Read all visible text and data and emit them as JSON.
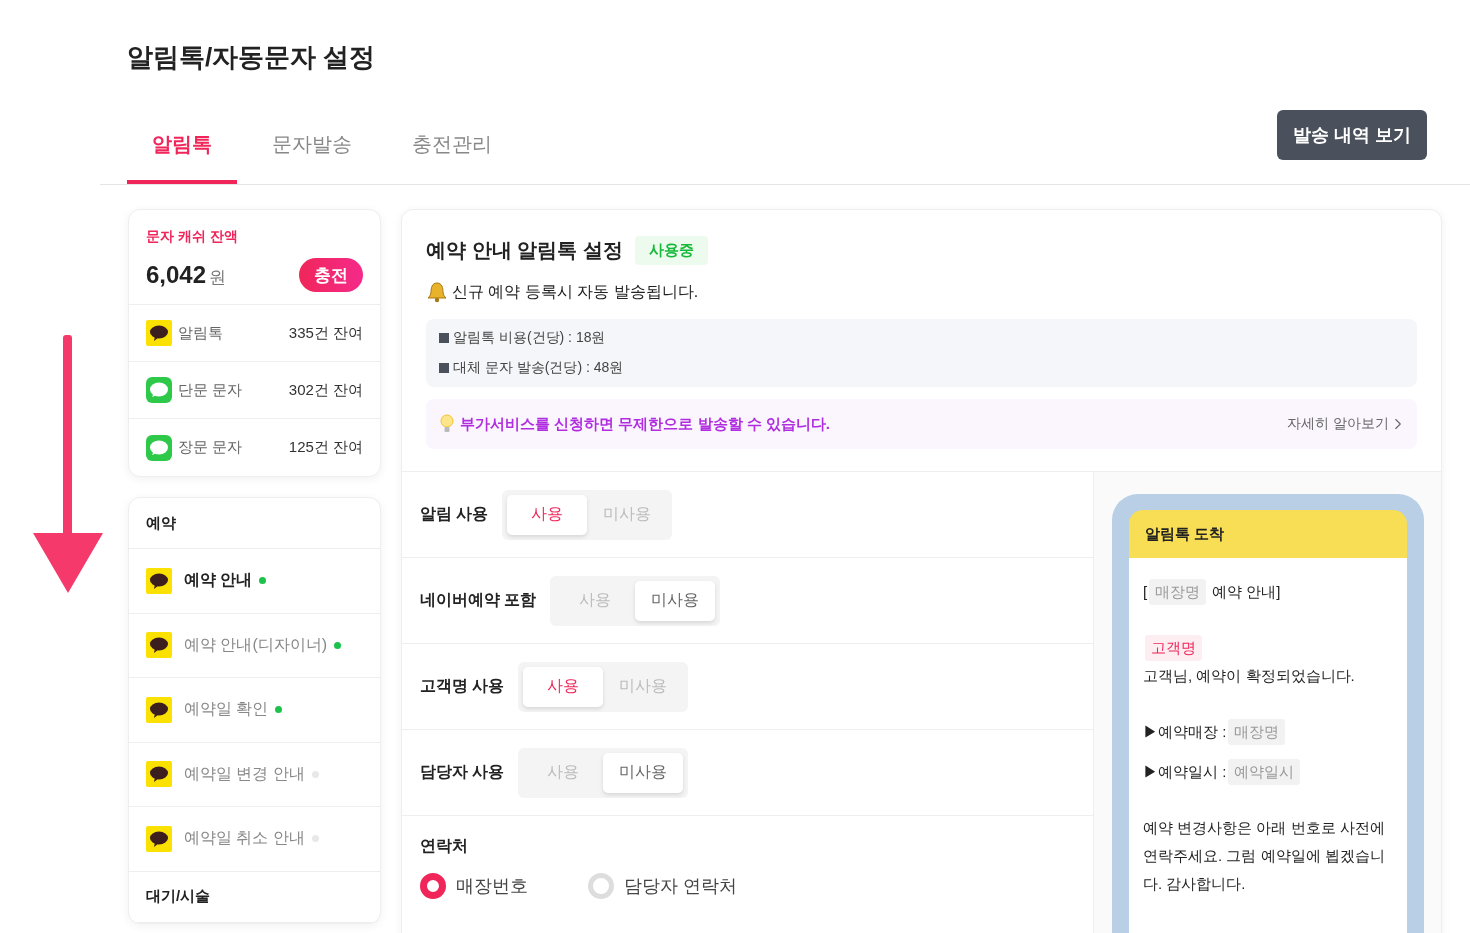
{
  "page_title": "알림톡/자동문자 설정",
  "tabs": [
    {
      "label": "알림톡",
      "selected": true
    },
    {
      "label": "문자발송",
      "selected": false
    },
    {
      "label": "충전관리",
      "selected": false
    }
  ],
  "history_button": "발송 내역 보기",
  "balance": {
    "label": "문자 캐쉬 잔액",
    "amount": "6,042",
    "unit": "원",
    "charge_button": "충전",
    "rows": [
      {
        "kind": "talk",
        "name": "알림톡",
        "count": "335건 잔여"
      },
      {
        "kind": "sms",
        "name": "단문 문자",
        "count": "302건 잔여"
      },
      {
        "kind": "sms",
        "name": "장문 문자",
        "count": "125건 잔여"
      }
    ]
  },
  "menu": [
    {
      "title": "예약",
      "items": [
        {
          "label": "예약 안내",
          "selected": true,
          "on": true
        },
        {
          "label": "예약 안내(디자이너)",
          "selected": false,
          "on": true
        },
        {
          "label": "예약일 확인",
          "selected": false,
          "on": true
        },
        {
          "label": "예약일 변경 안내",
          "selected": false,
          "on": false
        },
        {
          "label": "예약일 취소 안내",
          "selected": false,
          "on": false
        }
      ]
    },
    {
      "title": "대기/시술"
    }
  ],
  "detail": {
    "title": "예약 안내 알림톡 설정",
    "status": "사용중",
    "notice": "신규 예약 등록시 자동 발송됩니다.",
    "costs": [
      "알림톡 비용(건당) : 18원",
      "대체 문자 발송(건당) : 48원"
    ],
    "promo": "부가서비스를 신청하면 무제한으로 발송할 수 있습니다.",
    "promo_link": "자세히 알아보기",
    "settings": [
      {
        "label": "알림 사용",
        "options": [
          {
            "label": "사용",
            "selected": true
          },
          {
            "label": "미사용",
            "selected": false
          }
        ]
      },
      {
        "label": "네이버예약 포함",
        "options": [
          {
            "label": "사용",
            "selected": false
          },
          {
            "label": "미사용",
            "selected": true
          }
        ]
      },
      {
        "label": "고객명 사용",
        "options": [
          {
            "label": "사용",
            "selected": true
          },
          {
            "label": "미사용",
            "selected": false
          }
        ]
      },
      {
        "label": "담당자 사용",
        "options": [
          {
            "label": "사용",
            "selected": false
          },
          {
            "label": "미사용",
            "selected": true
          }
        ]
      }
    ],
    "contact": {
      "label": "연락처",
      "options": [
        {
          "label": "매장번호",
          "selected": true
        },
        {
          "label": "담당자 연락처",
          "selected": false
        }
      ]
    },
    "preview": {
      "header": "알림톡 도착",
      "paragraphs": [
        [
          {
            "kind": "text",
            "text": "["
          },
          {
            "kind": "var",
            "text": "매장명"
          },
          {
            "kind": "text",
            "text": "예약 안내]"
          }
        ],
        [
          {
            "kind": "name",
            "text": "고객명"
          },
          {
            "kind": "text",
            "text": "고객님, 예약이 확정되었습니다."
          }
        ],
        [
          {
            "kind": "text",
            "text": "▶예약매장 :"
          },
          {
            "kind": "var",
            "text": "매장명"
          }
        ],
        [
          {
            "kind": "text",
            "text": "▶예약일시 :"
          },
          {
            "kind": "var",
            "text": "예약일시"
          }
        ],
        [
          {
            "kind": "text",
            "text": "예약 변경사항은 아래 번호로 사전에 연락주세요. 그럼 예약일에 뵙겠습니다. 감사합니다."
          }
        ]
      ]
    }
  }
}
